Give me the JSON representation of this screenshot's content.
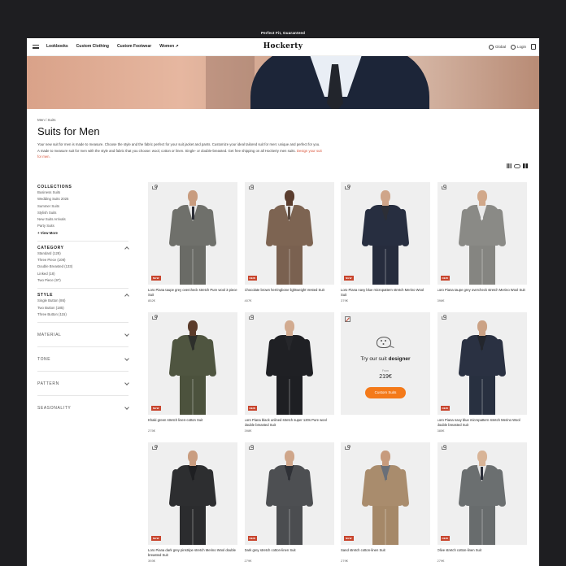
{
  "promo_bar": {
    "text": "Perfect Fit, Guaranteed"
  },
  "nav": {
    "links": [
      "Lookbooks",
      "Custom Clothing",
      "Custom Footwear",
      "Women ↗"
    ],
    "logo": "Hockerty",
    "global_label": "Global",
    "login_label": "Login"
  },
  "breadcrumb": "Men / Suits",
  "page_title": "Suits for Men",
  "description": {
    "line1": "Your new suit for men is made to measure. Choose the style and the fabric perfect for your suit jacket and pants. Customize your ideal tailored suit for men: unique and perfect for you. A made to measure suit for men with the style and fabric that you choose: wool, cotton or linen. Single- or double-breasted. Get free shipping on all Hockerty men suits.",
    "link": "Design your suit for men."
  },
  "sidebar": {
    "collections": {
      "title": "COLLECTIONS",
      "items": [
        "Business Suits",
        "Wedding Suits 2025",
        "Summer Suits",
        "Stylish Suits",
        "New Suits Arrivals",
        "Party Suits"
      ],
      "more": "+ View More"
    },
    "category": {
      "title": "CATEGORY",
      "items": [
        "Standard (128)",
        "Three Piece (108)",
        "Double Breasted (133)",
        "Linked (18)",
        "Two Piece (97)"
      ]
    },
    "style": {
      "title": "STYLE",
      "items": [
        "Single Button (86)",
        "Two Button (185)",
        "Three Button (115)"
      ]
    },
    "collapsed": [
      "MATERIAL",
      "TONE",
      "PATTERN",
      "SEASONALITY"
    ]
  },
  "products": [
    {
      "name": "Loro Piana taupe grey overcheck stretch Pure wool 3 piece Suit",
      "price": "852€",
      "badge": "NEW",
      "jacket": "#6f706b",
      "pants": "#6a6b66",
      "shirt": "#e7e7e7",
      "tie": "#2a2c35",
      "skin": "#c89c7f"
    },
    {
      "name": "Chocolate brown herringbone lightweight Vested Suit",
      "price": "407€",
      "badge": "NEW",
      "jacket": "#7d6452",
      "pants": "#7a6150",
      "shirt": "#e9e9e9",
      "tie": "#5b4a3f",
      "skin": "#5a3d2e"
    },
    {
      "name": "Loro Piana navy blue micropattern stretch Merino Wool Suit",
      "price": "379€",
      "badge": "NEW",
      "jacket": "#272e40",
      "pants": "#262c3d",
      "shirt": "#2c2e36",
      "tie": "#2c2e36",
      "skin": "#cfa589"
    },
    {
      "name": "Loro Piana taupe grey overcheck stretch Merino Wool Suit",
      "price": "396€",
      "badge": "NEW",
      "jacket": "#8a8a86",
      "pants": "#858581",
      "shirt": "#e9e9e9",
      "tie": "#e9e9e9",
      "skin": "#d1a88a"
    },
    {
      "name": "Khaki green stretch linen-cotton Suit",
      "price": "275€",
      "badge": "NEW",
      "jacket": "#4f5540",
      "pants": "#4c523d",
      "shirt": "#2d2f2b",
      "tie": "#2d2f2b",
      "skin": "#5b3c2b"
    },
    {
      "name": "Loro Piana black unlined stretch super 120s Pure wool double breasted Suit",
      "price": "398€",
      "badge": "NEW",
      "jacket": "#1f2024",
      "pants": "#1e1f23",
      "shirt": "#26272b",
      "tie": "#26272b",
      "skin": "#d2ab90"
    },
    {
      "name": "Loro Piana navy blue micropattern stretch Merino Wool double breasted Suit",
      "price": "385€",
      "badge": "NEW",
      "jacket": "#2a3142",
      "pants": "#283040",
      "shirt": "#23262d",
      "tie": "#23262d",
      "skin": "#cba285"
    },
    {
      "name": "Loro Piana dark grey pinstripe stretch Merino Wool double breasted Suit",
      "price": "393€",
      "badge": "NEW",
      "jacket": "#2d2e30",
      "pants": "#2b2c2e",
      "shirt": "#1e1f22",
      "tie": "#1e1f22",
      "skin": "#c99d80"
    },
    {
      "name": "Dark grey stretch cotton-linen Suit",
      "price": "279€",
      "badge": "NEW",
      "jacket": "#4d4f52",
      "pants": "#4b4d50",
      "shirt": "#2f3136",
      "tie": "#2f3136",
      "skin": "#cfa68a"
    },
    {
      "name": "Sand stretch cotton-linen Suit",
      "price": "279€",
      "badge": "NEW",
      "jacket": "#a98c6d",
      "pants": "#a58868",
      "shirt": "#6a6f78",
      "tie": "#6a6f78",
      "skin": "#c79b7d"
    },
    {
      "name": "Olive stretch cotton-linen Suit",
      "price": "279€",
      "badge": "NEW",
      "jacket": "#6b6f70",
      "pants": "#686c6d",
      "shirt": "#e6e6e6",
      "tie": "#2b2f3a",
      "skin": "#d8b497"
    }
  ],
  "designer_card": {
    "title_prefix": "Try our suit",
    "title_bold": "designer",
    "from_label": "From",
    "price": "219€",
    "button": "Custom Suits"
  }
}
